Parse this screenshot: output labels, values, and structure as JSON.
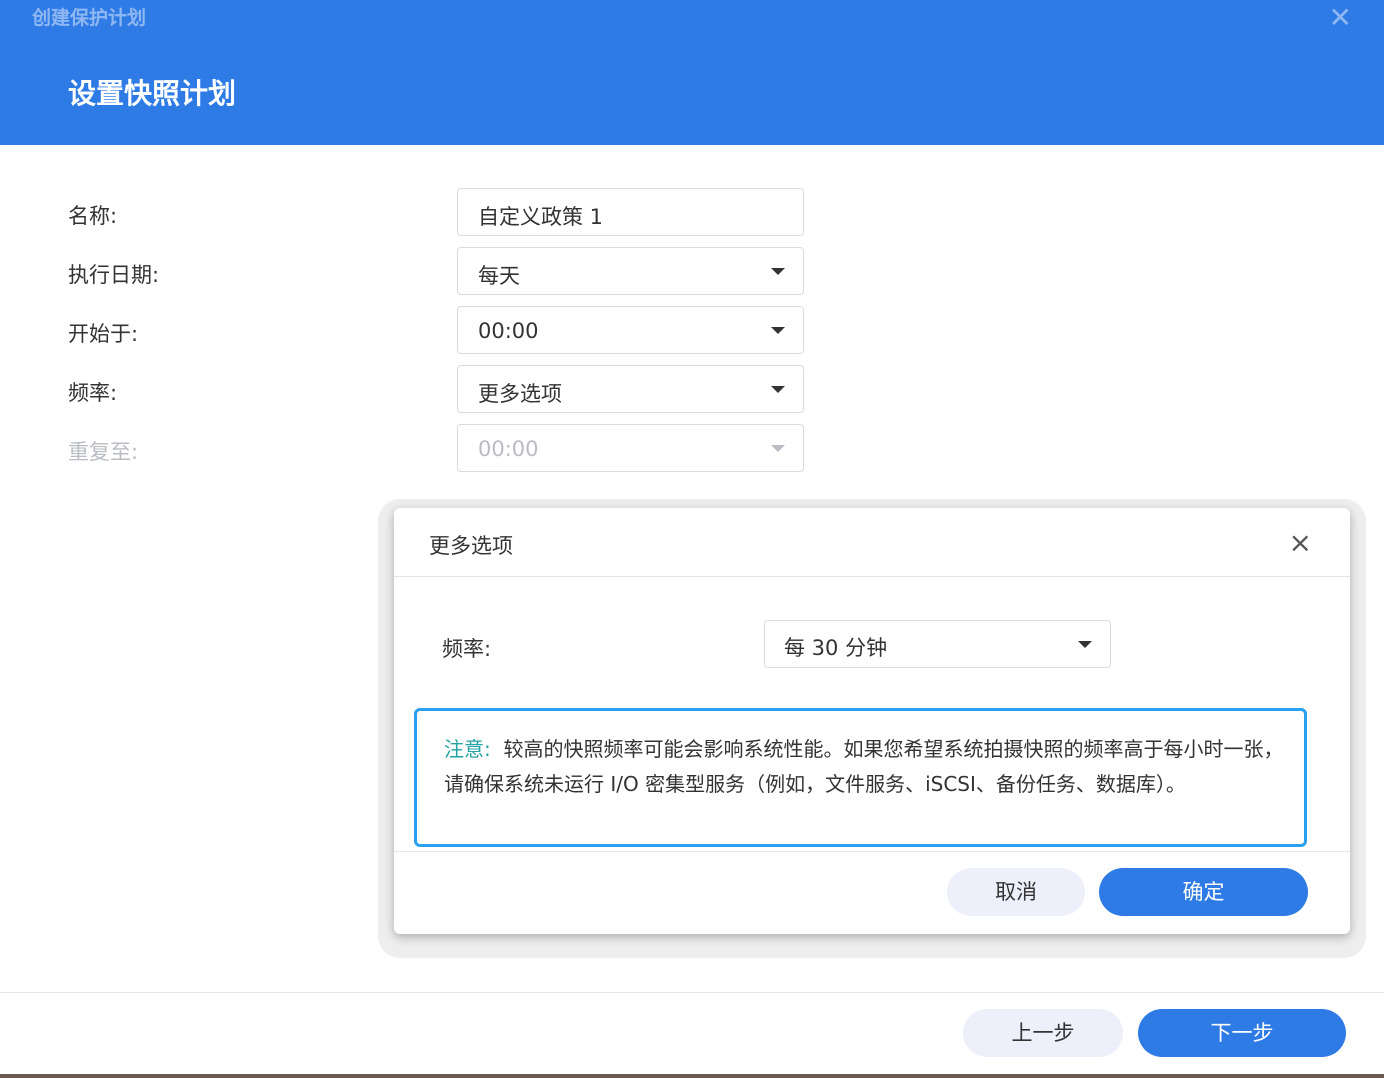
{
  "window": {
    "title": "创建保护计划",
    "close_icon": "close-icon"
  },
  "step_title": "设置快照计划",
  "form": {
    "name": {
      "label": "名称:",
      "value": "自定义政策 1"
    },
    "schedule_date": {
      "label": "执行日期:",
      "value": "每天"
    },
    "start_at": {
      "label": "开始于:",
      "value": "00:00"
    },
    "frequency": {
      "label": "频率:",
      "value": "更多选项"
    },
    "repeat_until": {
      "label": "重复至:",
      "value": "00:00",
      "disabled": true
    }
  },
  "dialog": {
    "title": "更多选项",
    "frequency_label": "频率:",
    "frequency_value": "每 30 分钟",
    "note_label": "注意:",
    "note_text": "较高的快照频率可能会影响系统性能。如果您希望系统拍摄快照的频率高于每小时一张，请确保系统未运行 I/O 密集型服务（例如，文件服务、iSCSI、备份任务、数据库）。",
    "cancel_label": "取消",
    "ok_label": "确定"
  },
  "footer": {
    "prev_label": "上一步",
    "next_label": "下一步"
  },
  "colors": {
    "primary": "#2f7be6",
    "note_border": "#2aa0f0",
    "note_label": "#23a3a3"
  }
}
